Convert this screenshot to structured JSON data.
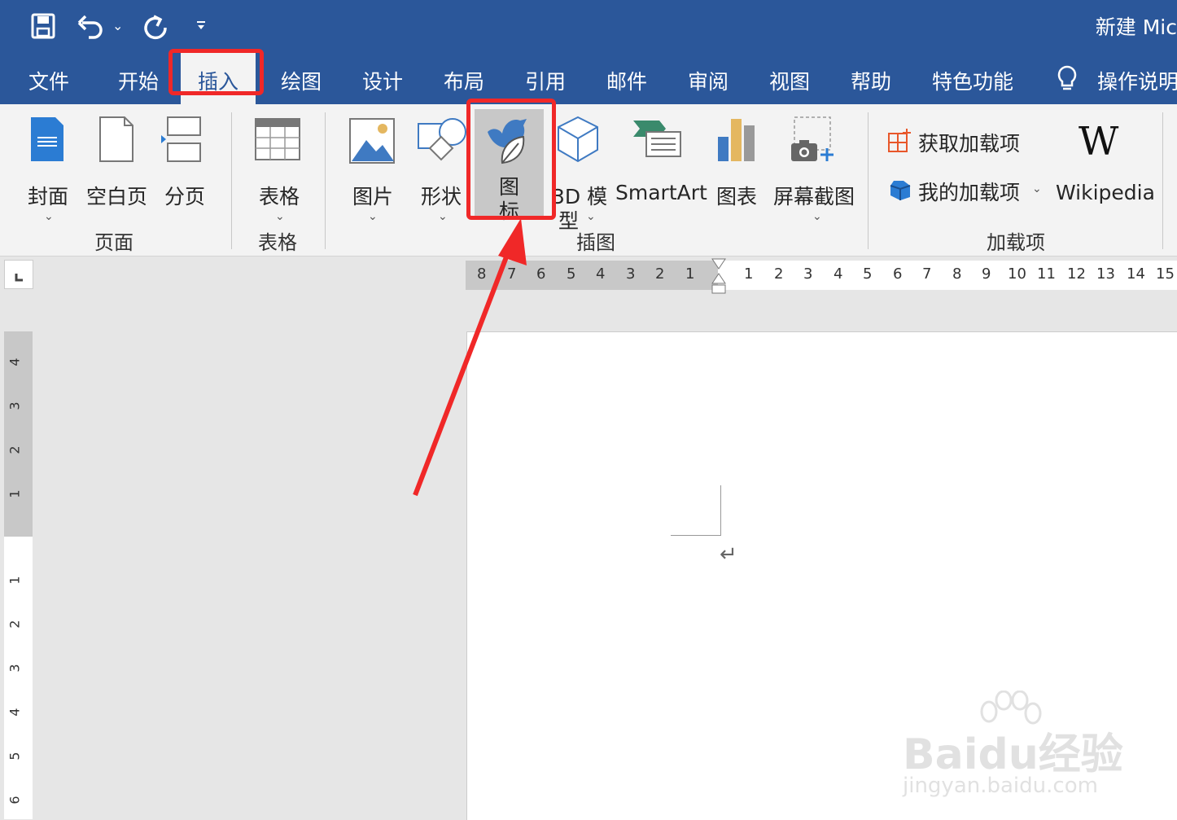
{
  "window": {
    "title": "新建 Mic"
  },
  "qat": {
    "save_icon": "save-icon",
    "undo_icon": "undo-icon",
    "redo_icon": "redo-icon",
    "customize_icon": "chevron-down-icon"
  },
  "tabs": [
    {
      "label": "文件"
    },
    {
      "label": "开始"
    },
    {
      "label": "插入"
    },
    {
      "label": "绘图"
    },
    {
      "label": "设计"
    },
    {
      "label": "布局"
    },
    {
      "label": "引用"
    },
    {
      "label": "邮件"
    },
    {
      "label": "审阅"
    },
    {
      "label": "视图"
    },
    {
      "label": "帮助"
    },
    {
      "label": "特色功能"
    },
    {
      "label": "操作说明"
    }
  ],
  "ribbon": {
    "pages": {
      "group_label": "页面",
      "cover": "封面",
      "blank": "空白页",
      "break": "分页"
    },
    "tables": {
      "group_label": "表格",
      "table": "表格"
    },
    "illustrations": {
      "group_label": "插图",
      "pictures": "图片",
      "shapes": "形状",
      "icons_line1": "图",
      "icons_line2": "标",
      "model_line1": "3D 模",
      "model_line2": "型",
      "smartart": "SmartArt",
      "chart": "图表",
      "screenshot": "屏幕截图"
    },
    "addins": {
      "group_label": "加载项",
      "get": "获取加载项",
      "my": "我的加载项",
      "wikipedia": "Wikipedia",
      "wiki_logo": "W"
    }
  },
  "ruler": {
    "h_left": [
      "8",
      "7",
      "6",
      "5",
      "4",
      "3",
      "2",
      "1"
    ],
    "h_right": [
      "1",
      "2",
      "3",
      "4",
      "5",
      "6",
      "7",
      "8",
      "9",
      "10",
      "11",
      "12",
      "13",
      "14",
      "15"
    ],
    "v_top": [
      "4",
      "3",
      "2",
      "1"
    ],
    "v_bottom": [
      "1",
      "2",
      "3",
      "4",
      "5",
      "6"
    ]
  },
  "document": {
    "paragraph_mark": "↵"
  },
  "watermark": {
    "brand": "Baidu经验",
    "url": "jingyan.baidu.com"
  },
  "colors": {
    "brand_blue": "#2b579a",
    "highlight_red": "#f02828"
  }
}
